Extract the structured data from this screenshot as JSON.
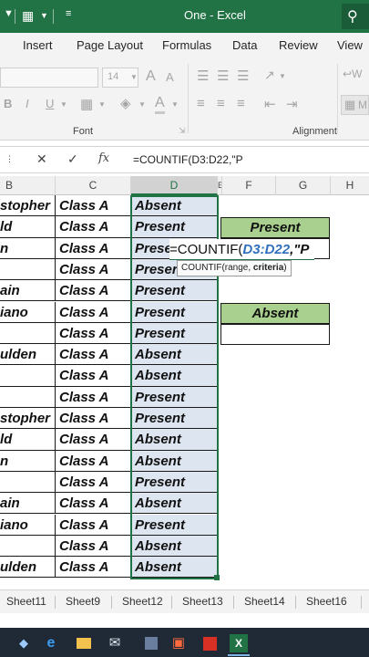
{
  "titlebar": {
    "title": "One  -  Excel",
    "qat_separator": "|",
    "qat_more": "☰"
  },
  "tabs": [
    "Insert",
    "Page Layout",
    "Formulas",
    "Data",
    "Review",
    "View"
  ],
  "ribbon": {
    "font_group": "Font",
    "alignment_group": "Alignment",
    "font_size": "14",
    "bold": "B",
    "italic": "I",
    "underline": "U",
    "grow_font": "A",
    "shrink_font": "A",
    "font_color": "A",
    "wrap_label": "W",
    "merge_label": "M"
  },
  "formula_bar": {
    "cancel": "✕",
    "enter": "✓",
    "fx": "fx",
    "text": "=COUNTIF(D3:D22,\"P"
  },
  "columns": [
    "B",
    "C",
    "D",
    "E",
    "F",
    "G",
    "H"
  ],
  "rows": [
    {
      "b": "stopher",
      "c": "Class A",
      "d": "Absent"
    },
    {
      "b": "ld",
      "c": "Class A",
      "d": "Present"
    },
    {
      "b": "n",
      "c": "Class A",
      "d": "Prese"
    },
    {
      "b": "",
      "c": "Class A",
      "d": "Preser"
    },
    {
      "b": "ain",
      "c": "Class A",
      "d": "Present"
    },
    {
      "b": "iano",
      "c": "Class A",
      "d": "Present"
    },
    {
      "b": "",
      "c": "Class A",
      "d": "Present"
    },
    {
      "b": "ulden",
      "c": "Class A",
      "d": "Absent"
    },
    {
      "b": "",
      "c": "Class A",
      "d": "Absent"
    },
    {
      "b": "",
      "c": "Class A",
      "d": "Present"
    },
    {
      "b": "stopher",
      "c": "Class A",
      "d": "Present"
    },
    {
      "b": "ld",
      "c": "Class A",
      "d": "Absent"
    },
    {
      "b": "n",
      "c": "Class A",
      "d": "Absent"
    },
    {
      "b": "",
      "c": "Class A",
      "d": "Present"
    },
    {
      "b": "ain",
      "c": "Class A",
      "d": "Absent"
    },
    {
      "b": "iano",
      "c": "Class A",
      "d": "Present"
    },
    {
      "b": "",
      "c": "Class A",
      "d": "Absent"
    },
    {
      "b": "ulden",
      "c": "Class A",
      "d": "Absent"
    }
  ],
  "summary": {
    "present_label": "Present",
    "absent_label": "Absent"
  },
  "editing": {
    "prefix": "=COUNTIF(",
    "ref": "D3:D22",
    "comma": ",",
    "str": "\"P"
  },
  "tooltip": {
    "fn": "COUNTIF(range, ",
    "bold": "criteria",
    "end": ")"
  },
  "sheets": [
    "Sheet11",
    "Sheet9",
    "Sheet12",
    "Sheet13",
    "Sheet14",
    "Sheet16"
  ],
  "taskbar": {
    "start": "◆",
    "edge": "e",
    "excel": "X"
  },
  "colors": {
    "excel_green": "#217346",
    "summary_fill": "#a9d08e",
    "range_fill": "#dde5f0",
    "ref_blue": "#2f6fbd"
  }
}
